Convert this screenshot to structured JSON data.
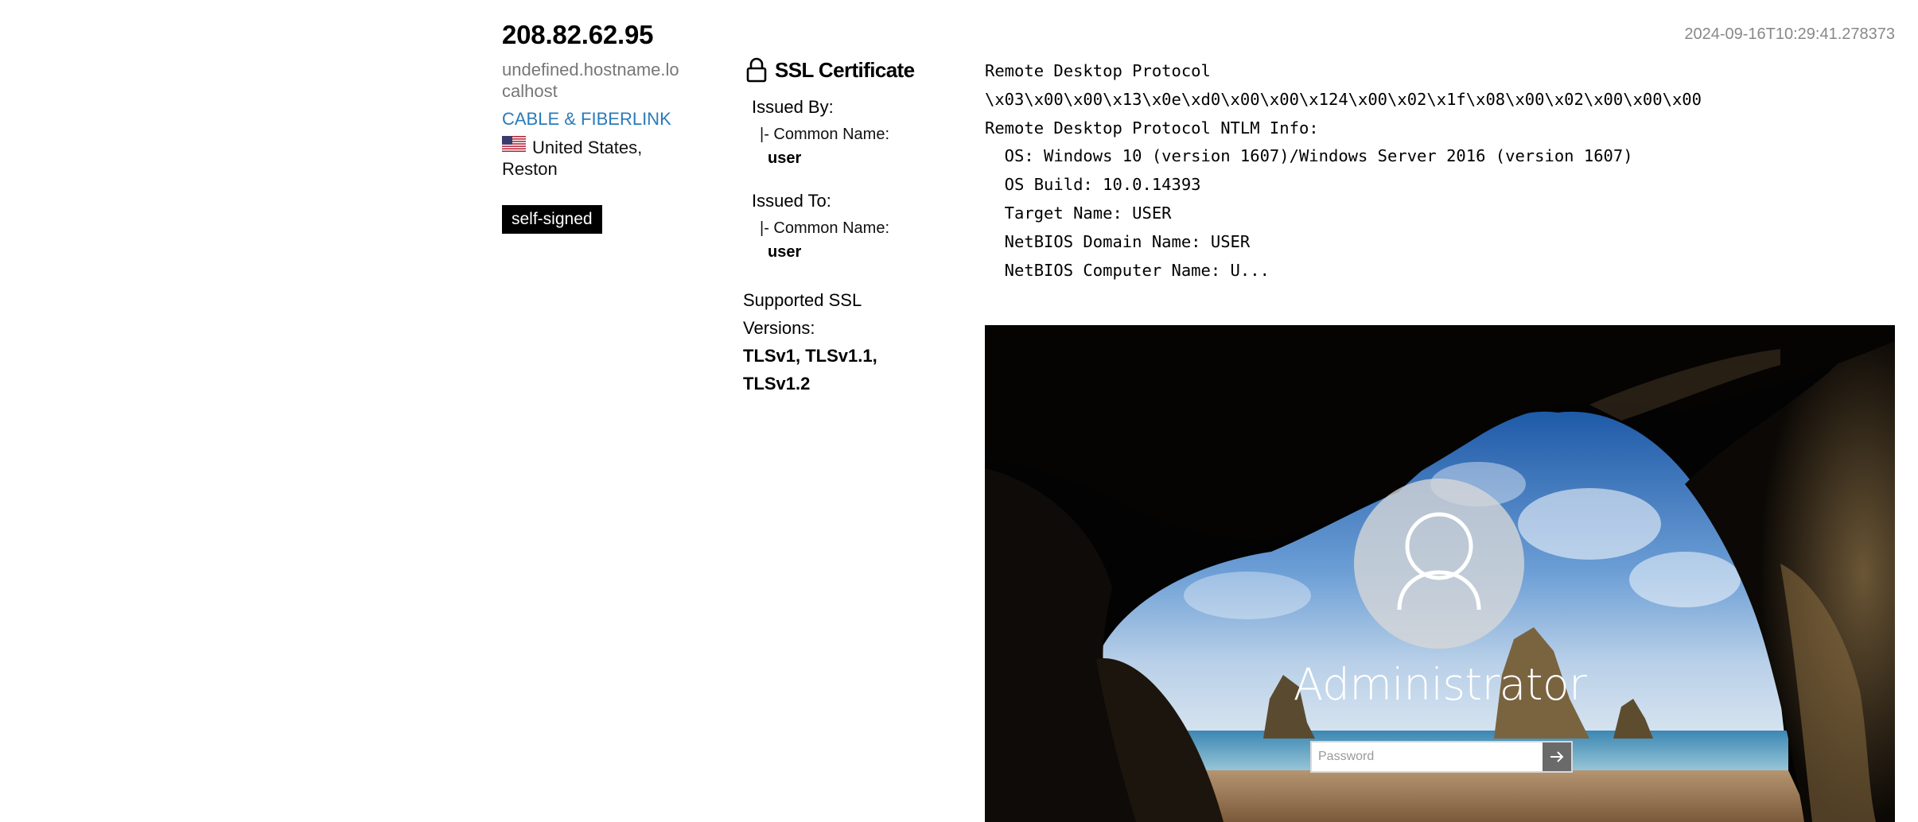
{
  "host": {
    "ip": "208.82.62.95",
    "hostname": "undefined.hostname.localhost",
    "org": "CABLE & FIBERLINK",
    "location": "United States, Reston",
    "flag_icon": "us-flag-icon",
    "badge": "self-signed"
  },
  "timestamp": "2024-09-16T10:29:41.278373",
  "ssl": {
    "icon": "lock-icon",
    "title": "SSL Certificate",
    "issued_by_label": "Issued By:",
    "issued_by_cn_label": "|- Common Name:",
    "issued_by_cn_value": "user",
    "issued_to_label": "Issued To:",
    "issued_to_cn_label": "|- Common Name:",
    "issued_to_cn_value": "user",
    "versions_label": "Supported SSL Versions:",
    "versions_value": "TLSv1, TLSv1.1, TLSv1.2"
  },
  "banner": {
    "text": "Remote Desktop Protocol\n\\x03\\x00\\x00\\x13\\x0e\\xd0\\x00\\x00\\x124\\x00\\x02\\x1f\\x08\\x00\\x02\\x00\\x00\\x00\nRemote Desktop Protocol NTLM Info:\n  OS: Windows 10 (version 1607)/Windows Server 2016 (version 1607)\n  OS Build: 10.0.14393\n  Target Name: USER\n  NetBIOS Domain Name: USER\n  NetBIOS Computer Name: U..."
  },
  "screenshot": {
    "username": "Administrator",
    "password_placeholder": "Password",
    "avatar_icon": "user-icon",
    "submit_icon": "arrow-right-icon"
  }
}
